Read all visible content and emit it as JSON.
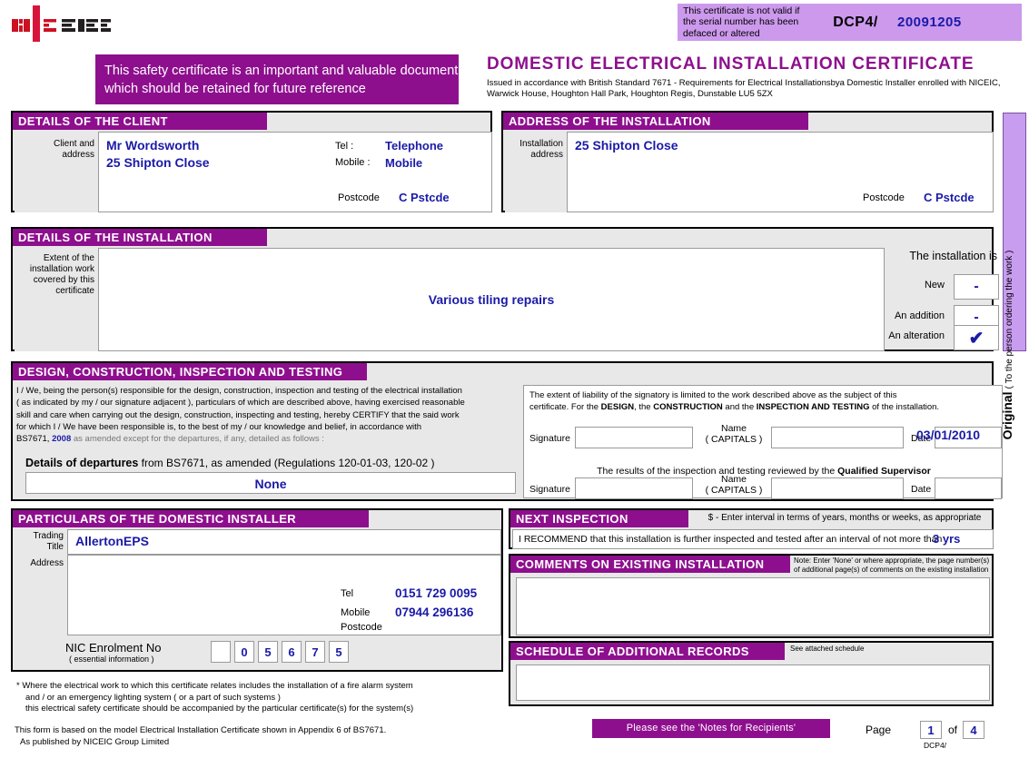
{
  "logo": {
    "part_red": "NI",
    "part_dark": "CEIC",
    "alt": "NICEIC logo"
  },
  "safety_notice": "This safety certificate is an important and valuable document which should be retained for future reference",
  "serial": {
    "note": "This certificate is not valid if the serial number has been defaced or altered",
    "prefix": "DCP4/",
    "number": "20091205"
  },
  "title": {
    "main": "DOMESTIC ELECTRICAL INSTALLATION CERTIFICATE",
    "issued": "Issued in accordance with British Standard 7671 - Requirements for Electrical Installationsbya Domestic Installer enrolled with NICEIC, Warwick House, Houghton Hall Park, Houghton Regis, Dunstable LU5 5ZX"
  },
  "client": {
    "header": "DETAILS OF THE CLIENT",
    "side_label_1": "Client and",
    "side_label_2": "address",
    "name": "Mr Wordsworth",
    "address": "25 Shipton Close",
    "tel_label": "Tel :",
    "tel_value": "Telephone",
    "mobile_label": "Mobile :",
    "mobile_value": "Mobile",
    "postcode_label": "Postcode",
    "postcode_value": "C Pstcde"
  },
  "installation_address": {
    "header": "ADDRESS OF THE INSTALLATION",
    "side_label_1": "Installation",
    "side_label_2": "address",
    "address": "25 Shipton Close",
    "postcode_label": "Postcode",
    "postcode_value": "C Pstcde"
  },
  "installation_details": {
    "header": "DETAILS OF THE INSTALLATION",
    "side_label": "Extent of the installation work covered by this certificate",
    "extent_value": "Various tiling repairs",
    "installation_is_label": "The installation is",
    "options": [
      {
        "label": "New",
        "mark": "-",
        "type": "dash"
      },
      {
        "label": "An addition",
        "mark": "-",
        "type": "dash"
      },
      {
        "label": "An alteration",
        "mark": "✔",
        "type": "check"
      }
    ]
  },
  "original_strip": {
    "word": "Original",
    "sub": "( To the person ordering the work )"
  },
  "design": {
    "header": "DESIGN, CONSTRUCTION, INSPECTION AND TESTING",
    "body_1": "I / We, being the person(s) responsible for the design, construction, inspection and testing of the electrical installation",
    "body_2": "( as indicated by my / our signature adjacent ), particulars of which are described above, having exercised reasonable",
    "body_3": "skill and care when carrying out the design, construction, inspecting and testing, hereby CERTIFY that the said work",
    "body_4": "for which I / We have been responsible is, to the best of my / our knowledge and belief, in accordance with",
    "body_5_pre": "BS7671, ",
    "body_5_year": "2008",
    "body_5_post": " as amended except for the departures, if any, detailed as follows :",
    "departures_bold": "Details of departures",
    "departures_rest": " from BS7671, as amended  (Regulations 120-01-03, 120-02 )",
    "departures_value": "None",
    "liability_1": "The extent of liability of the signatory is limited to the work described above as the subject of this",
    "liability_2_a": "certificate. For the ",
    "liability_2_design": "DESIGN",
    "liability_2_b": ", the ",
    "liability_2_construction": "CONSTRUCTION",
    "liability_2_c": " and the ",
    "liability_2_inspection": "INSPECTION AND TESTING",
    "liability_2_d": " of the installation.",
    "signature_label": "Signature",
    "name_label_1": "Name",
    "name_label_2": "( CAPITALS )",
    "date_label": "Date",
    "date_value": "03/01/2010",
    "qs_note_pre": "The results of the inspection and testing reviewed by the ",
    "qs_note_bold": "Qualified Supervisor",
    "signature2_label": "Signature",
    "date2_label": "Date",
    "date2_value": ""
  },
  "particulars": {
    "header": "PARTICULARS OF THE DOMESTIC INSTALLER",
    "trading_label_1": "Trading",
    "trading_label_2": "Title",
    "trading_value": "AllertonEPS",
    "address_label": "Address",
    "tel_label": "Tel",
    "tel_value": "0151 729 0095",
    "mobile_label": "Mobile",
    "mobile_value": "07944 296136",
    "postcode_label": "Postcode",
    "postcode_value": "",
    "nic_label": "NIC Enrolment No",
    "nic_sub": "( essential information )",
    "nic_digits": [
      "",
      "0",
      "5",
      "6",
      "7",
      "5"
    ]
  },
  "next_inspection": {
    "header": "NEXT INSPECTION",
    "note": "$ - Enter interval in terms of years, months or weeks, as appropriate",
    "text": "I RECOMMEND that this installation is further inspected and tested after an interval of not more than",
    "value": "3 yrs"
  },
  "comments": {
    "header": "COMMENTS ON EXISTING INSTALLATION",
    "note": "Note: Enter 'None' or where appropriate, the page number(s) of additional page(s) of comments on the existing installation",
    "value": ""
  },
  "schedule": {
    "header": "SCHEDULE OF ADDITIONAL RECORDS",
    "note": "See attached schedule",
    "value": ""
  },
  "footnotes": {
    "star_1": "* Where the electrical work to which this certificate relates includes the installation of a fire alarm system",
    "star_2": "and / or an emergency lighting system ( or a part of such systems )",
    "star_3": "this electrical safety certificate should be accompanied by the particular certificate(s) for the system(s)",
    "form_1": "This form is based on the model Electrical Installation Certificate shown in Appendix 6 of BS7671.",
    "form_2": "As published by NICEIC Group Limited"
  },
  "bottom": {
    "notes_bar": "Please see the 'Notes for Recipients'",
    "page_label": "Page",
    "page_current": "1",
    "page_of": "of",
    "page_total": "4",
    "page_code": "DCP4/"
  },
  "colors": {
    "purple": "#8E0F8E",
    "light_purple": "#CC99ED",
    "strip_purple": "#C89CEE",
    "value_blue": "#1A1AA8",
    "panel_grey": "#E8E8E8",
    "logo_red": "#CC1122"
  }
}
